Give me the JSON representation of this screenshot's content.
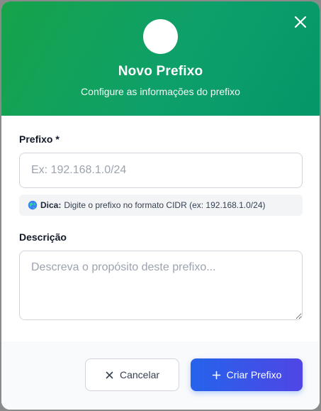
{
  "modal": {
    "title": "Novo Prefixo",
    "subtitle": "Configure as informações do prefixo"
  },
  "form": {
    "prefix_label": "Prefixo *",
    "prefix_placeholder": "Ex: 192.168.1.0/24",
    "hint_icon": "globe-icon",
    "hint_strong": "Dica:",
    "hint_text": "Digite o prefixo no formato CIDR (ex: 192.168.1.0/24)",
    "description_label": "Descrição",
    "description_placeholder": "Descreva o propósito deste prefixo..."
  },
  "footer": {
    "cancel_label": "Cancelar",
    "create_label": "Criar Prefixo"
  },
  "colors": {
    "header_gradient_start": "#16a34a",
    "header_gradient_end": "#059669",
    "primary_button": "#2563eb"
  }
}
